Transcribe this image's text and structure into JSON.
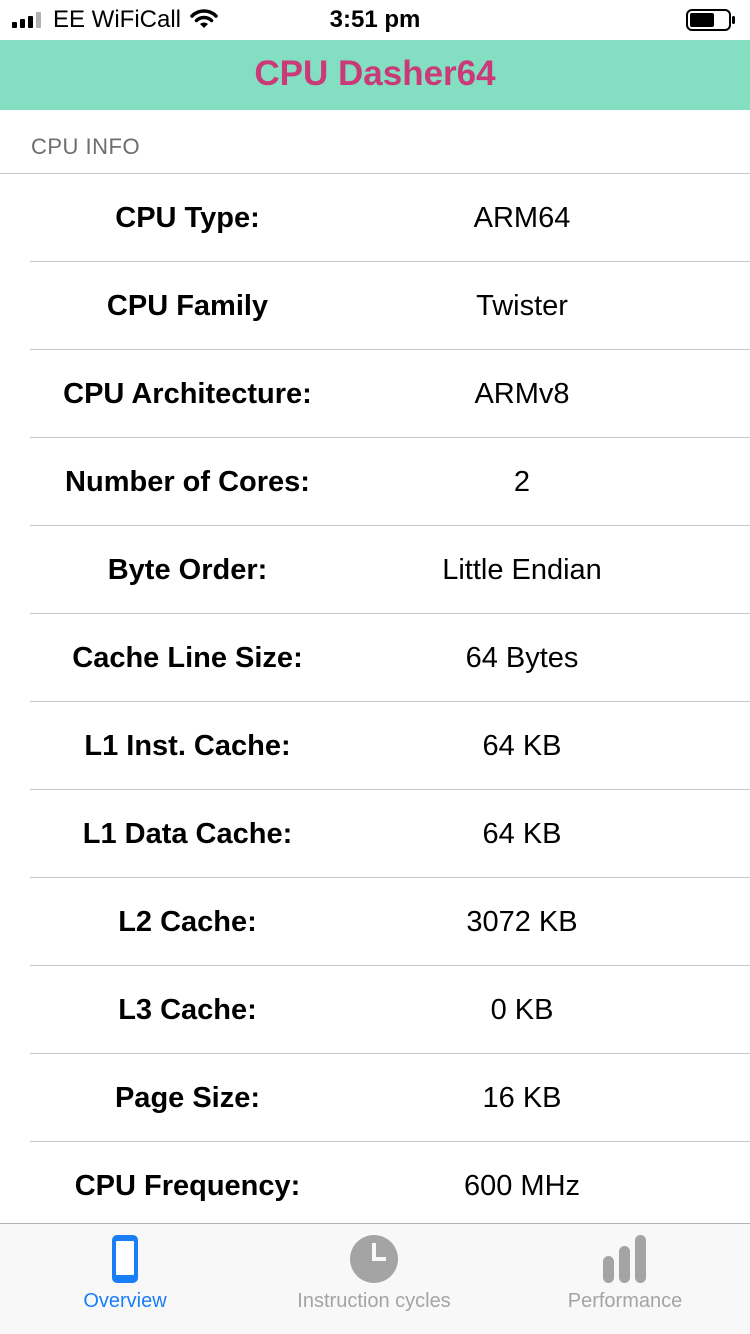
{
  "status_bar": {
    "carrier": "EE WiFiCall",
    "time": "3:51 pm"
  },
  "nav": {
    "title": "CPU Dasher64",
    "background_color": "#84dec2",
    "title_color": "#cb3a78"
  },
  "section": {
    "header": "CPU INFO"
  },
  "rows": [
    {
      "label": "CPU Type:",
      "value": "ARM64"
    },
    {
      "label": "CPU Family",
      "value": "Twister"
    },
    {
      "label": "CPU Architecture:",
      "value": "ARMv8"
    },
    {
      "label": "Number of Cores:",
      "value": "2"
    },
    {
      "label": "Byte Order:",
      "value": "Little Endian"
    },
    {
      "label": "Cache Line Size:",
      "value": "64 Bytes"
    },
    {
      "label": "L1 Inst. Cache:",
      "value": "64 KB"
    },
    {
      "label": "L1 Data Cache:",
      "value": "64 KB"
    },
    {
      "label": "L2 Cache:",
      "value": "3072 KB"
    },
    {
      "label": "L3 Cache:",
      "value": "0 KB"
    },
    {
      "label": "Page Size:",
      "value": "16 KB"
    },
    {
      "label": "CPU Frequency:",
      "value": "600 MHz"
    }
  ],
  "tabs": [
    {
      "label": "Overview",
      "icon": "phone-icon",
      "active": true
    },
    {
      "label": "Instruction cycles",
      "icon": "clock-icon",
      "active": false
    },
    {
      "label": "Performance",
      "icon": "bar-chart-icon",
      "active": false
    }
  ],
  "colors": {
    "active_tab": "#1a7ff6",
    "inactive_tab": "#a4a4a4"
  }
}
